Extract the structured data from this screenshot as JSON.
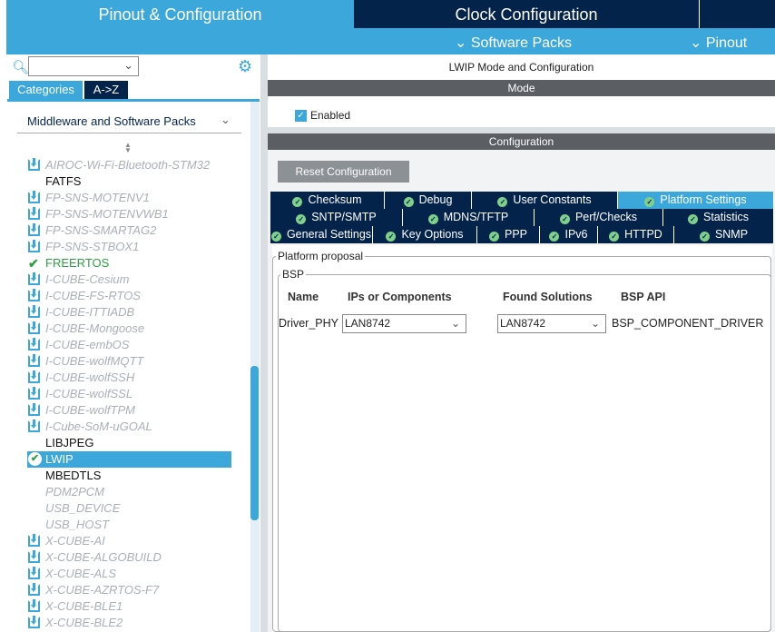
{
  "header": {
    "pinout_config": "Pinout & Configuration",
    "clock_config": "Clock Configuration",
    "software_packs": "Software Packs",
    "pinout": "Pinout"
  },
  "left": {
    "search_placeholder": "",
    "tabs": [
      "Categories",
      "A->Z"
    ],
    "category": "Middleware and Software Packs",
    "items": [
      {
        "label": "AIROC-Wi-Fi-Bluetooth-STM32",
        "type": "dl"
      },
      {
        "label": "FATFS",
        "type": "plain"
      },
      {
        "label": "FP-SNS-MOTENV1",
        "type": "dl"
      },
      {
        "label": "FP-SNS-MOTENVWB1",
        "type": "dl"
      },
      {
        "label": "FP-SNS-SMARTAG2",
        "type": "dl"
      },
      {
        "label": "FP-SNS-STBOX1",
        "type": "dl"
      },
      {
        "label": "FREERTOS",
        "type": "check"
      },
      {
        "label": "I-CUBE-Cesium",
        "type": "dl"
      },
      {
        "label": "I-CUBE-FS-RTOS",
        "type": "dl"
      },
      {
        "label": "I-CUBE-ITTIADB",
        "type": "dl"
      },
      {
        "label": "I-CUBE-Mongoose",
        "type": "dl"
      },
      {
        "label": "I-CUBE-embOS",
        "type": "dl"
      },
      {
        "label": "I-CUBE-wolfMQTT",
        "type": "dl"
      },
      {
        "label": "I-CUBE-wolfSSH",
        "type": "dl"
      },
      {
        "label": "I-CUBE-wolfSSL",
        "type": "dl"
      },
      {
        "label": "I-CUBE-wolfTPM",
        "type": "dl"
      },
      {
        "label": "I-Cube-SoM-uGOAL",
        "type": "dl"
      },
      {
        "label": "LIBJPEG",
        "type": "plain"
      },
      {
        "label": "LWIP",
        "type": "sel"
      },
      {
        "label": "MBEDTLS",
        "type": "plain"
      },
      {
        "label": "PDM2PCM",
        "type": "gray"
      },
      {
        "label": "USB_DEVICE",
        "type": "gray"
      },
      {
        "label": "USB_HOST",
        "type": "gray"
      },
      {
        "label": "X-CUBE-AI",
        "type": "dl"
      },
      {
        "label": "X-CUBE-ALGOBUILD",
        "type": "dl"
      },
      {
        "label": "X-CUBE-ALS",
        "type": "dl"
      },
      {
        "label": "X-CUBE-AZRTOS-F7",
        "type": "dl"
      },
      {
        "label": "X-CUBE-BLE1",
        "type": "dl"
      },
      {
        "label": "X-CUBE-BLE2",
        "type": "dl"
      }
    ]
  },
  "right": {
    "title": "LWIP Mode and Configuration",
    "mode_header": "Mode",
    "enabled_label": "Enabled",
    "enabled": true,
    "config_header": "Configuration",
    "reset_button": "Reset Configuration",
    "tab_rows": [
      [
        {
          "label": "Checksum",
          "w": 126
        },
        {
          "label": "Debug",
          "w": 96
        },
        {
          "label": "User Constants",
          "w": 161
        },
        {
          "label": "Platform Settings",
          "w": 172,
          "active": true
        }
      ],
      [
        {
          "label": "SNTP/SMTP",
          "w": 146
        },
        {
          "label": "MDNS/TFTP",
          "w": 145
        },
        {
          "label": "Perf/Checks",
          "w": 142
        },
        {
          "label": "Statistics",
          "w": 122
        }
      ],
      [
        {
          "label": "General Settings",
          "w": 113
        },
        {
          "label": "Key Options",
          "w": 115
        },
        {
          "label": "PPP",
          "w": 69
        },
        {
          "label": "IPv6",
          "w": 64
        },
        {
          "label": "HTTPD",
          "w": 84
        },
        {
          "label": "SNMP",
          "w": 110
        }
      ]
    ],
    "platform_proposal": "Platform proposal",
    "bsp": "BSP",
    "columns": [
      "Name",
      "IPs or Components",
      "Found Solutions",
      "BSP API"
    ],
    "row": {
      "name": "Driver_PHY",
      "ip": "LAN8742",
      "found": "LAN8742",
      "api": "BSP_COMPONENT_DRIVER"
    }
  }
}
